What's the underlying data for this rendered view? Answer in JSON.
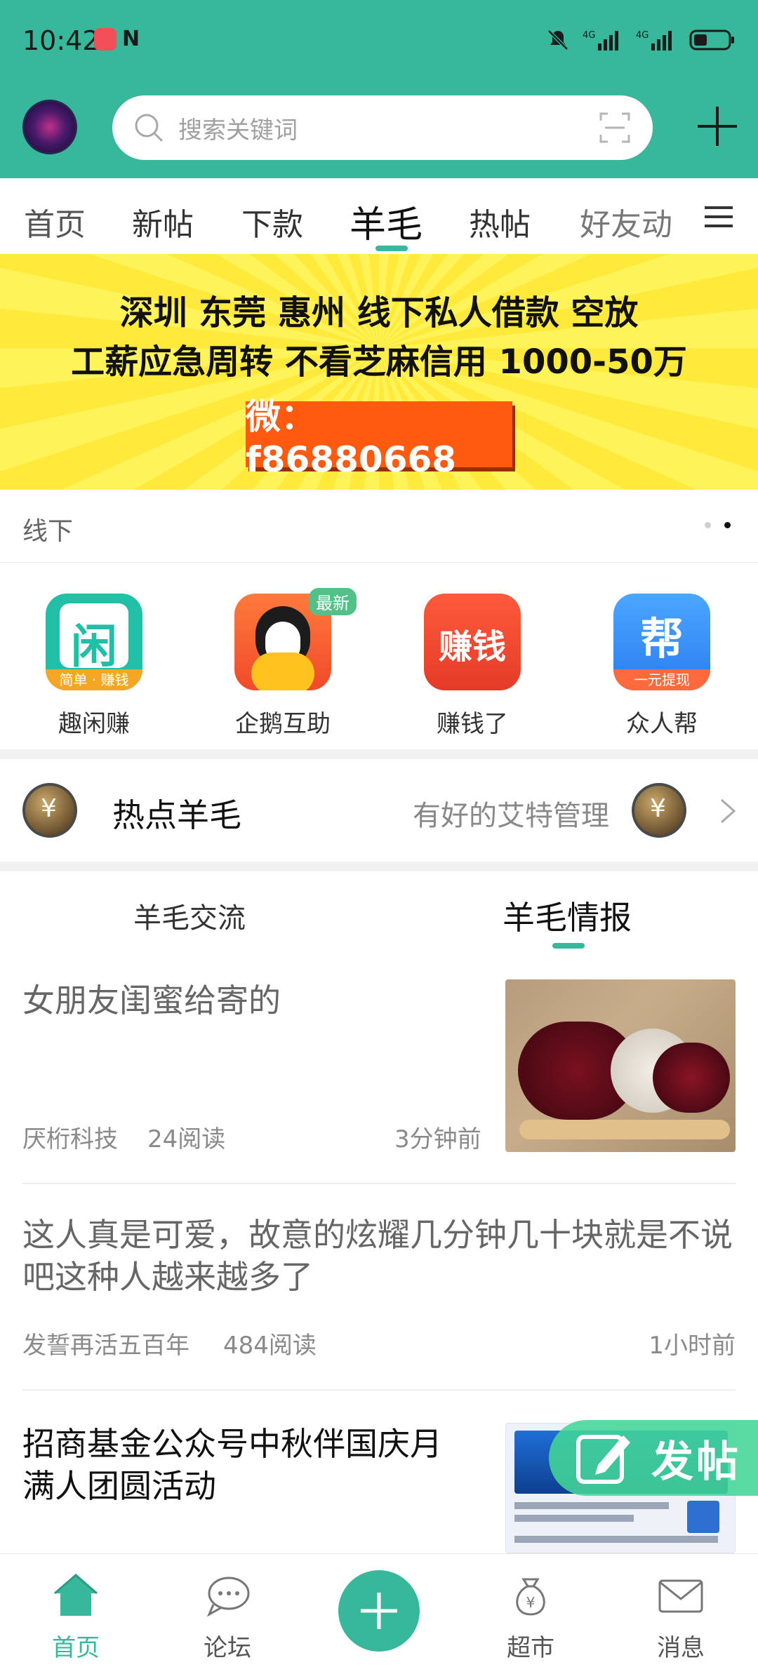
{
  "status": {
    "time": "10:42",
    "battery": ""
  },
  "header": {
    "search_placeholder": "搜索关键词"
  },
  "tabs": [
    "首页",
    "新帖",
    "下款",
    "羊毛",
    "热帖",
    "好友动"
  ],
  "active_tab_index": 3,
  "banner": {
    "line1": "深圳 东莞 惠州 线下私人借款 空放",
    "line2": "工薪应急周转 不看芝麻信用  1000-50万",
    "contact": "微：f86880668"
  },
  "subhead": {
    "label": "线下"
  },
  "apps": [
    {
      "label": "趣闲赚",
      "icon_text": "闲",
      "icon_sub": "简单 · 赚钱",
      "tag": ""
    },
    {
      "label": "企鹅互助",
      "icon_text": "",
      "icon_sub": "",
      "tag": "最新"
    },
    {
      "label": "赚钱了",
      "icon_text": "赚钱",
      "icon_sub": "",
      "tag": ""
    },
    {
      "label": "众人帮",
      "icon_text": "帮",
      "icon_sub": "一元提现",
      "tag": ""
    }
  ],
  "hot": {
    "title": "热点羊毛",
    "right_text": "有好的艾特管理"
  },
  "section_tabs": [
    "羊毛交流",
    "羊毛情报"
  ],
  "active_section_index": 1,
  "posts": [
    {
      "title": "女朋友闺蜜给寄的",
      "author": "厌桁科技",
      "reads": "24阅读",
      "time": "3分钟前"
    },
    {
      "title": "这人真是可爱，故意的炫耀几分钟几十块就是不说吧这种人越来越多了",
      "author": "发誓再活五百年",
      "reads": "484阅读",
      "time": "1小时前"
    },
    {
      "title": "招商基金公众号中秋伴国庆月满人团圆活动",
      "author": "",
      "reads": "",
      "time": ""
    }
  ],
  "fab": {
    "label": "发帖"
  },
  "bottom_nav": [
    {
      "label": "首页",
      "icon": "home-icon"
    },
    {
      "label": "论坛",
      "icon": "chat-icon"
    },
    {
      "label": "",
      "icon": "add-icon"
    },
    {
      "label": "超市",
      "icon": "money-bag-icon"
    },
    {
      "label": "消息",
      "icon": "mail-icon"
    }
  ],
  "colors": {
    "accent": "#37b89a",
    "banner_bg": "#ffe93b",
    "banner_button": "#ff5a0f"
  }
}
